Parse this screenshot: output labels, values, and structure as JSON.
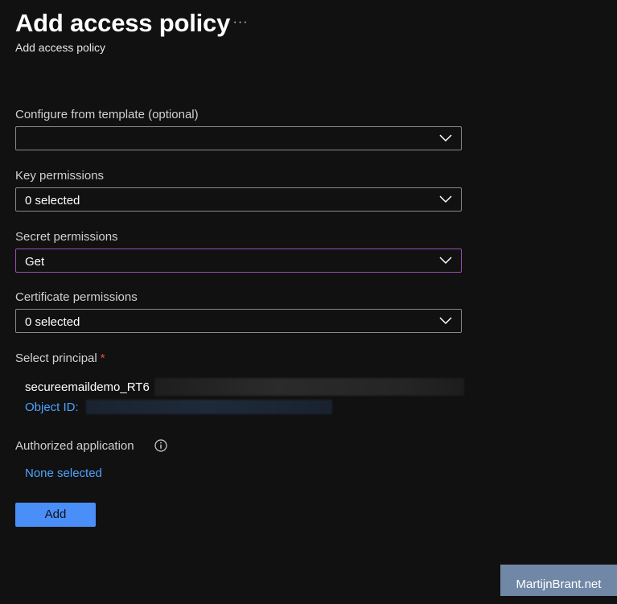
{
  "header": {
    "title": "Add access policy",
    "more_label": "···",
    "subtitle": "Add access policy"
  },
  "form": {
    "template": {
      "label": "Configure from template (optional)",
      "value": ""
    },
    "key_permissions": {
      "label": "Key permissions",
      "value": "0 selected"
    },
    "secret_permissions": {
      "label": "Secret permissions",
      "value": "Get"
    },
    "certificate_permissions": {
      "label": "Certificate permissions",
      "value": "0 selected"
    },
    "principal": {
      "label": "Select principal",
      "required_marker": "*",
      "name": "secureemaildemo_RT6",
      "object_id_label": "Object ID: "
    },
    "authorized_application": {
      "label": "Authorized application",
      "info_icon": "info-icon",
      "value": "None selected"
    },
    "add_label": "Add"
  },
  "watermark": "MartijnBrant.net",
  "colors": {
    "background": "#111111",
    "link": "#4da3ff",
    "primary_button": "#4a8ff7",
    "active_border": "#9c4fb5",
    "required": "#e0523f"
  }
}
